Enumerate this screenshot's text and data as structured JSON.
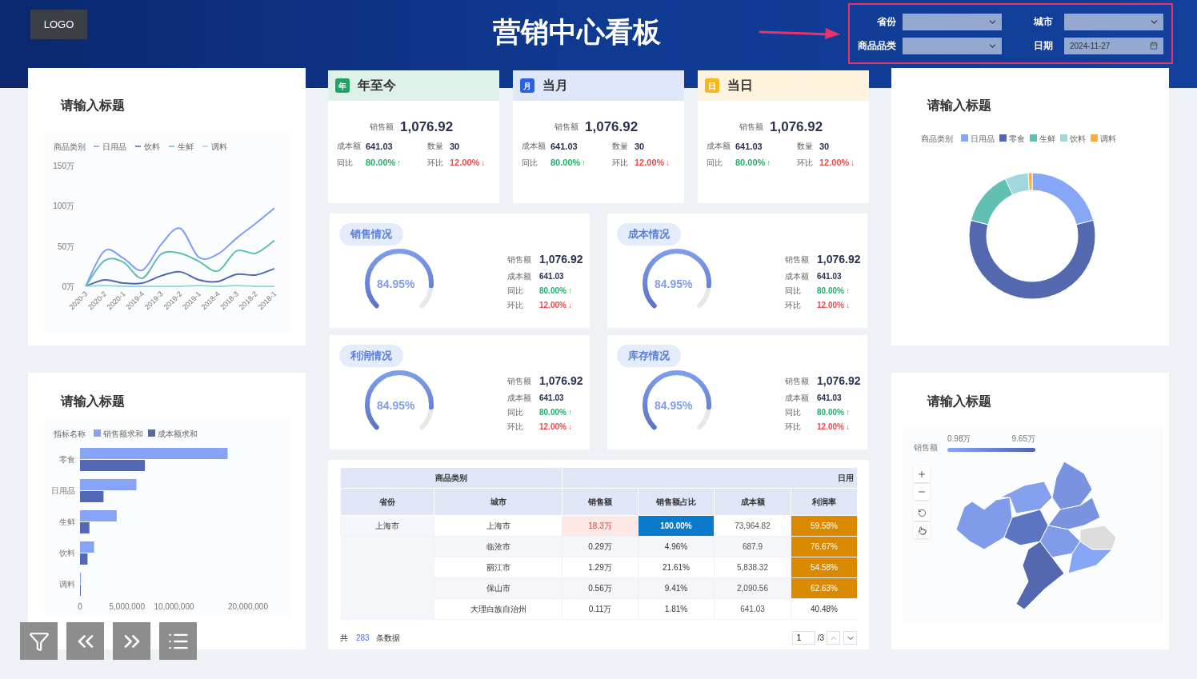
{
  "header": {
    "logo": "LOGO",
    "title": "营销中心看板"
  },
  "filters": [
    {
      "label": "省份",
      "kind": "select"
    },
    {
      "label": "城市",
      "kind": "select"
    },
    {
      "label": "商品品类",
      "kind": "select"
    },
    {
      "label": "日期",
      "kind": "date",
      "value": "2024-11-27"
    }
  ],
  "line_panel": {
    "title": "请输入标题",
    "chart_data": {
      "type": "line",
      "legend": {
        "title": "商品类别"
      },
      "categories": [
        "2020-3",
        "2020-2",
        "2020-1",
        "2019-4",
        "2019-3",
        "2019-2",
        "2019-1",
        "2018-4",
        "2018-3",
        "2018-2",
        "2018-1"
      ],
      "ylim": [
        0,
        150
      ],
      "yticks": [
        {
          "value": 0,
          "label": "0万"
        },
        {
          "value": 50,
          "label": "50万"
        },
        {
          "value": 100,
          "label": "100万"
        },
        {
          "value": 150,
          "label": "150万"
        }
      ],
      "series": [
        {
          "name": "日用品",
          "color": "#7f9ef5",
          "values": [
            0,
            44,
            35,
            20,
            52,
            72,
            36,
            40,
            60,
            78,
            97
          ]
        },
        {
          "name": "饮料",
          "color": "#5067b2",
          "values": [
            0,
            8,
            4,
            4,
            13,
            18,
            8,
            6,
            15,
            14,
            22
          ]
        },
        {
          "name": "生鲜",
          "color": "#5fbfb1",
          "values": [
            0,
            32,
            30,
            10,
            40,
            41,
            31,
            19,
            44,
            41,
            57
          ]
        },
        {
          "name": "调料",
          "color": "#9ed8e0",
          "values": [
            0,
            1,
            0,
            0,
            0,
            0,
            1,
            0,
            1,
            0,
            0
          ]
        }
      ]
    }
  },
  "bar_panel": {
    "title": "请输入标题",
    "chart_data": {
      "type": "bar",
      "orientation": "horizontal",
      "legend": {
        "title": "指标名称"
      },
      "categories": [
        "零食",
        "日用品",
        "生鲜",
        "饮料",
        "调料"
      ],
      "xlim": [
        0,
        20000000
      ],
      "xticks": [
        {
          "value": 0,
          "label": "0"
        },
        {
          "value": 5000000,
          "label": "5,000,000"
        },
        {
          "value": 10000000,
          "label": "10,000,000"
        },
        {
          "value": 20000000,
          "label": "20,000,000"
        }
      ],
      "series": [
        {
          "name": "销售额求和",
          "color": "#86a3f6",
          "values": [
            15700000,
            6000000,
            3900000,
            1500000,
            100000
          ]
        },
        {
          "name": "成本额求和",
          "color": "#5469b3",
          "values": [
            6900000,
            2500000,
            1000000,
            800000,
            0
          ]
        }
      ]
    }
  },
  "kpi_cards": [
    {
      "title": "年至今",
      "icon_text": "年",
      "color": "#1fa463",
      "main": {
        "label": "销售额",
        "value": "1,076.92"
      },
      "stats": [
        {
          "label": "成本额",
          "value": "641.03"
        },
        {
          "label": "数量",
          "value": "30"
        },
        {
          "label": "同比",
          "value": "80.00%",
          "arrow": "↑",
          "rising": true
        },
        {
          "label": "环比",
          "value": "12.00%",
          "arrow": "↓",
          "rising": false
        }
      ]
    },
    {
      "title": "当月",
      "icon_text": "月",
      "color": "#2a62e0",
      "main": {
        "label": "销售额",
        "value": "1,076.92"
      },
      "stats": [
        {
          "label": "成本额",
          "value": "641.03"
        },
        {
          "label": "数量",
          "value": "30"
        },
        {
          "label": "同比",
          "value": "80.00%",
          "arrow": "↑",
          "rising": true
        },
        {
          "label": "环比",
          "value": "12.00%",
          "arrow": "↓",
          "rising": false
        }
      ]
    },
    {
      "title": "当日",
      "icon_text": "日",
      "color": "#f5b81c",
      "main": {
        "label": "销售额",
        "value": "1,076.92"
      },
      "stats": [
        {
          "label": "成本额",
          "value": "641.03"
        },
        {
          "label": "数量",
          "value": "30"
        },
        {
          "label": "同比",
          "value": "80.00%",
          "arrow": "↑",
          "rising": true
        },
        {
          "label": "环比",
          "value": "12.00%",
          "arrow": "↓",
          "rising": false
        }
      ]
    }
  ],
  "gauge_cards": [
    {
      "title": "销售情况",
      "level": 0.8495,
      "reading": "84.95%",
      "main": {
        "label": "销售额",
        "value": "1,076.92"
      },
      "stats": [
        {
          "label": "成本额",
          "value": "641.03"
        },
        {
          "label": "同比",
          "value": "80.00%",
          "arrow": "↑",
          "rising": true
        },
        {
          "label": "环比",
          "value": "12.00%",
          "arrow": "↓",
          "rising": false
        }
      ]
    },
    {
      "title": "成本情况",
      "level": 0.8495,
      "reading": "84.95%",
      "main": {
        "label": "销售额",
        "value": "1,076.92"
      },
      "stats": [
        {
          "label": "成本额",
          "value": "641.03"
        },
        {
          "label": "同比",
          "value": "80.00%",
          "arrow": "↑",
          "rising": true
        },
        {
          "label": "环比",
          "value": "12.00%",
          "arrow": "↓",
          "rising": false
        }
      ]
    },
    {
      "title": "利润情况",
      "level": 0.8495,
      "reading": "84.95%",
      "main": {
        "label": "销售额",
        "value": "1,076.92"
      },
      "stats": [
        {
          "label": "成本额",
          "value": "641.03"
        },
        {
          "label": "同比",
          "value": "80.00%",
          "arrow": "↑",
          "rising": true
        },
        {
          "label": "环比",
          "value": "12.00%",
          "arrow": "↓",
          "rising": false
        }
      ]
    },
    {
      "title": "库存情况",
      "level": 0.8495,
      "reading": "84.95%",
      "main": {
        "label": "销售额",
        "value": "1,076.92"
      },
      "stats": [
        {
          "label": "成本额",
          "value": "641.03"
        },
        {
          "label": "同比",
          "value": "80.00%",
          "arrow": "↑",
          "rising": true
        },
        {
          "label": "环比",
          "value": "12.00%",
          "arrow": "↓",
          "rising": false
        }
      ]
    }
  ],
  "table": {
    "group_headers": [
      "商品类别",
      "日用"
    ],
    "columns": [
      "省份",
      "城市",
      "销售额",
      "销售额占比",
      "成本额",
      "利润率"
    ],
    "rows": [
      {
        "province": "上海市",
        "city": "上海市",
        "sales": {
          "text": "18.3万",
          "highlighted": true
        },
        "share": {
          "text": "100.00%",
          "highlighted": true
        },
        "cost": "73,964.82",
        "margin": {
          "text": "59.58%",
          "highlighted": true
        }
      },
      {
        "city": "临沧市",
        "sales": {
          "text": "0.29万",
          "highlighted": false
        },
        "share": {
          "text": "4.96%",
          "highlighted": false
        },
        "cost": "687.9",
        "margin": {
          "text": "76.67%",
          "highlighted": true
        }
      },
      {
        "city": "丽江市",
        "sales": {
          "text": "1.29万",
          "highlighted": false
        },
        "share": {
          "text": "21.61%",
          "highlighted": false
        },
        "cost": "5,838.32",
        "margin": {
          "text": "54.58%",
          "highlighted": true
        }
      },
      {
        "city": "保山市",
        "sales": {
          "text": "0.56万",
          "highlighted": false
        },
        "share": {
          "text": "9.41%",
          "highlighted": false
        },
        "cost": "2,090.56",
        "margin": {
          "text": "62.63%",
          "highlighted": true
        }
      },
      {
        "city": "大理白族自治州",
        "sales": {
          "text": "0.11万",
          "highlighted": false
        },
        "share": {
          "text": "1.81%",
          "highlighted": false
        },
        "cost": "641.03",
        "margin": {
          "text": "40.48%",
          "highlighted": false
        }
      }
    ],
    "footer": {
      "prefix": "共",
      "count": "283",
      "suffix": "条数据",
      "page": "1",
      "pages": "/3"
    }
  },
  "donut_panel": {
    "title": "请输入标题",
    "chart_data": {
      "type": "donut",
      "legend": {
        "title": "商品类别"
      },
      "categories": [
        "日用品",
        "零食",
        "生鲜",
        "饮料",
        "调料"
      ],
      "colors": [
        "#86a6f7",
        "#5468b0",
        "#62bfb4",
        "#9fd6df",
        "#f9ad3e"
      ],
      "values": [
        21,
        58,
        14,
        6,
        1
      ]
    }
  },
  "map_panel": {
    "title": "请输入标题",
    "visual_map": {
      "label": "销售额",
      "min": "0.98万",
      "max": "9.65万",
      "level": 1
    }
  }
}
